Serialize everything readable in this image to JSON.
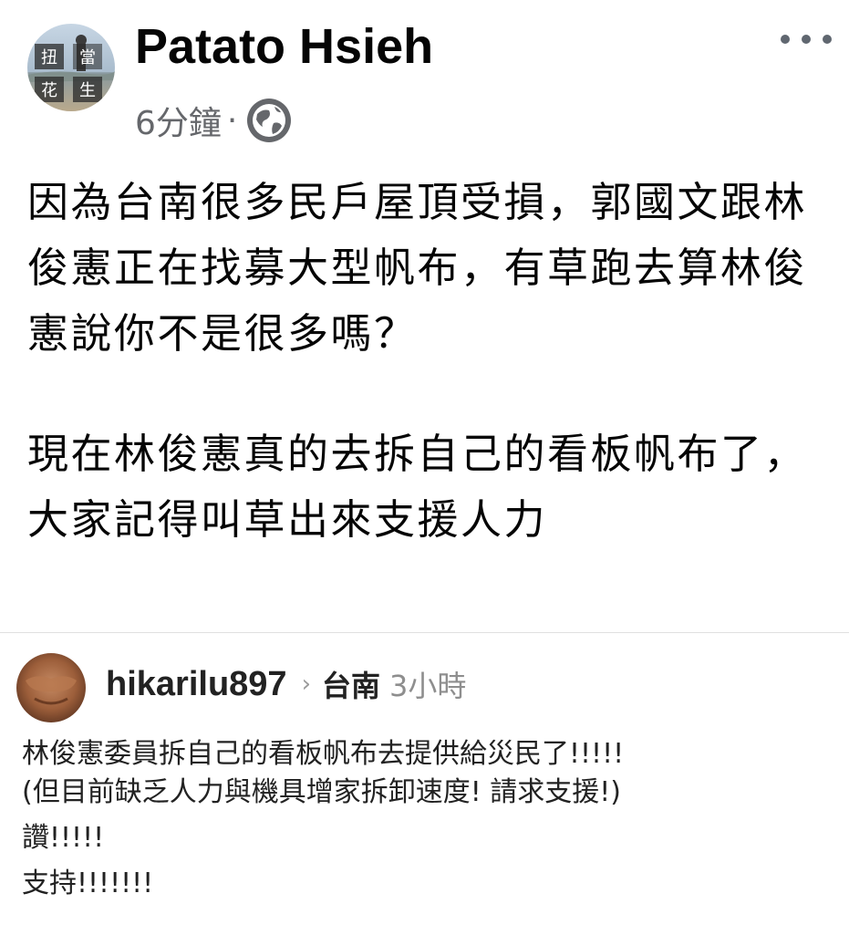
{
  "post": {
    "author_name": "Patato Hsieh",
    "avatar_label": "扭當花生",
    "timestamp": "6分鐘",
    "separator": "·",
    "audience_icon": "globe-icon",
    "more_icon": "more-options-icon",
    "paragraphs": [
      "因為台南很多民戶屋頂受損，郭國文跟林俊憲正在找募大型帆布，有草跑去算林俊憲說你不是很多嗎？",
      "現在林俊憲真的去拆自己的看板帆布了，大家記得叫草出來支援人力"
    ]
  },
  "embedded_screenshot": {
    "username": "hikarilu897",
    "chevron": "›",
    "location": "台南",
    "time": "3小時",
    "lines": [
      "林俊憲委員拆自己的看板帆布去提供給災民了!!!!!",
      "(但目前缺乏人力與機具增家拆卸速度! 請求支援!)",
      "讚!!!!!",
      "支持!!!!!!!"
    ]
  },
  "colors": {
    "text_primary": "#050505",
    "text_secondary": "#65676b",
    "icon_gray": "#606770"
  }
}
